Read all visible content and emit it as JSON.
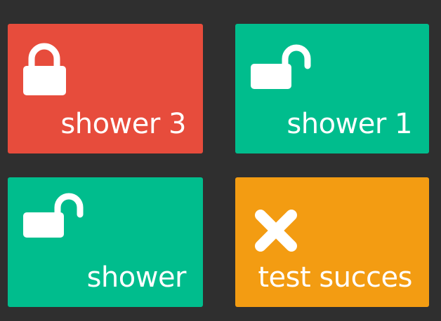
{
  "colors": {
    "background": "#2f2f2f",
    "locked": "#e74c3c",
    "unlocked": "#00bd8d",
    "error": "#f39c12",
    "text": "#ffffff"
  },
  "tiles": [
    {
      "label": "shower 3",
      "icon": "lock-closed-icon",
      "state": "locked"
    },
    {
      "label": "shower 1",
      "icon": "lock-open-icon",
      "state": "unlocked"
    },
    {
      "label": "shower",
      "icon": "lock-open-icon",
      "state": "unlocked"
    },
    {
      "label": "test succes",
      "icon": "close-x-icon",
      "state": "error"
    }
  ]
}
